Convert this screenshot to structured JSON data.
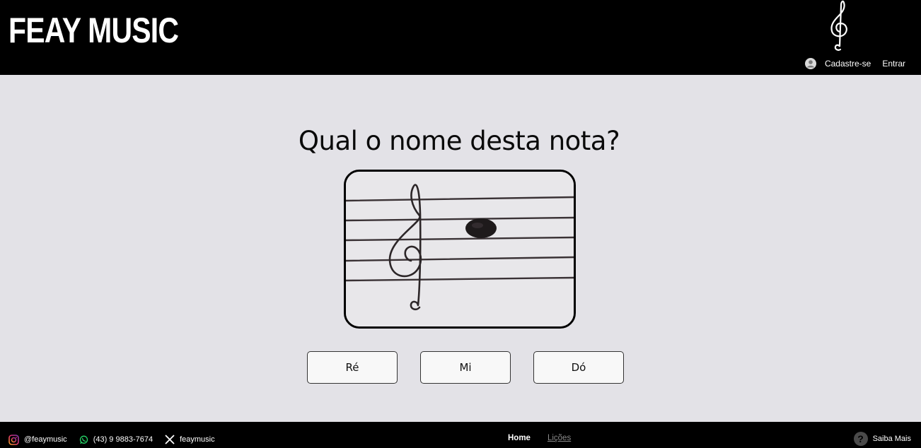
{
  "header": {
    "brand": "FEAY MUSIC",
    "logo_icon": "treble-clef-icon",
    "auth": {
      "user_icon": "user-circle-icon",
      "signup_label": "Cadastre-se",
      "login_label": "Entrar"
    }
  },
  "main": {
    "question": "Qual o nome desta nota?",
    "image": {
      "icon": "treble-clef-staff-note-image",
      "description_hidden": true
    },
    "answers": [
      {
        "label": "Ré"
      },
      {
        "label": "Mi"
      },
      {
        "label": "Dó"
      }
    ]
  },
  "footer": {
    "social": {
      "instagram": {
        "icon": "instagram-icon",
        "label": "@feaymusic"
      },
      "whatsapp": {
        "icon": "whatsapp-icon",
        "label": "(43) 9 9883-7674"
      },
      "x": {
        "icon": "x-icon",
        "label": "feaymusic"
      }
    },
    "nav": {
      "home": "Home",
      "licoes": "Lições"
    },
    "help": {
      "icon": "question-icon",
      "label": "Saiba Mais",
      "symbol": "?"
    }
  },
  "colors": {
    "header_bg": "#000000",
    "page_bg": "#e3e2e7",
    "whatsapp_green": "#25d366",
    "nav_inactive": "#8a8a8a"
  }
}
